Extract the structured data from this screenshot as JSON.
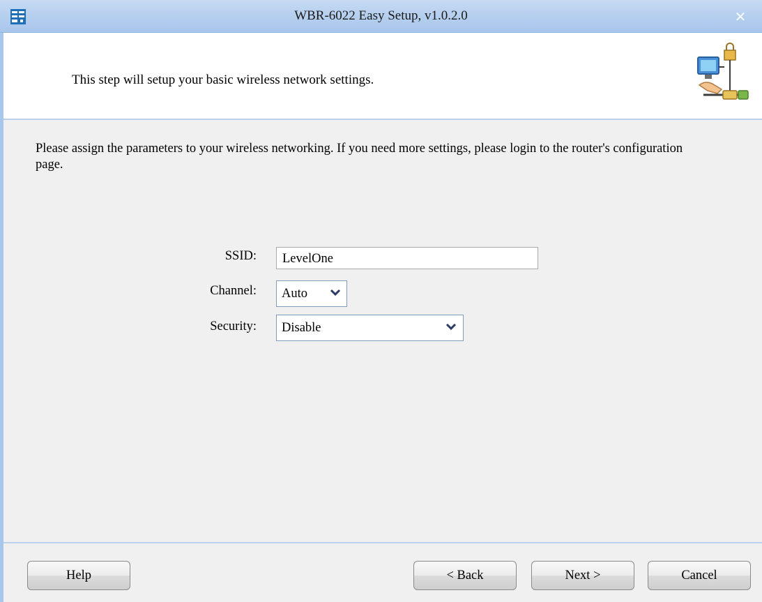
{
  "window": {
    "title": "WBR-6022 Easy Setup, v1.0.2.0",
    "close_symbol": "✕"
  },
  "header": {
    "description": "This step will setup your basic wireless network settings.",
    "logo_icon": "network-setup-icon"
  },
  "intro_text": "Please assign the parameters to your wireless networking. If you need more settings, please login to the router's configuration page.",
  "form": {
    "ssid_label": "SSID:",
    "ssid_value": "LevelOne",
    "channel_label": "Channel:",
    "channel_value": "Auto",
    "security_label": "Security:",
    "security_value": "Disable"
  },
  "buttons": {
    "help": "Help",
    "back": "< Back",
    "next": "Next >",
    "cancel": "Cancel"
  },
  "colors": {
    "titlebar": "#b7d0ef",
    "separator": "#b9d1ea",
    "background": "#f0f0f0"
  }
}
